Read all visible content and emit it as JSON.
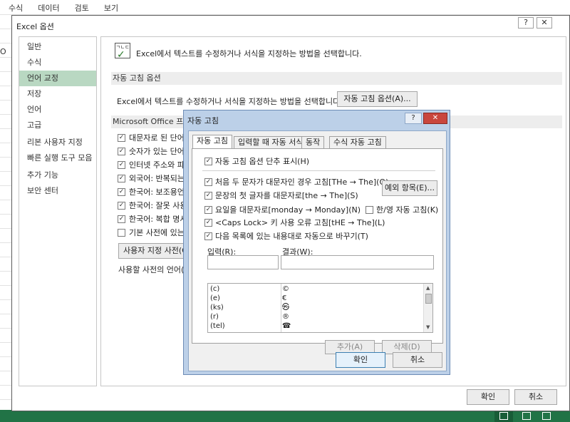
{
  "excel": {
    "ribbon_tabs": [
      "수식",
      "데이터",
      "검토",
      "보기"
    ],
    "cell_fragment": "O"
  },
  "options_dialog": {
    "title": "Excel 옵션",
    "help_icon": "?",
    "close_icon": "✕",
    "nav_items": [
      "일반",
      "수식",
      "언어 교정",
      "저장",
      "언어",
      "고급",
      "리본 사용자 지정",
      "빠른 실행 도구 모음",
      "추가 기능",
      "보안 센터"
    ],
    "selected_nav": "언어 교정",
    "header_icon_text": "ㄱㄴㄷ",
    "header_text": "Excel에서 텍스트를 수정하거나 서식을 지정하는 방법을 선택합니다.",
    "autocorrect_section": "자동 고침 옵션",
    "autocorrect_desc": "Excel에서 텍스트를 수정하거나 서식을 지정하는 방법을 선택합니다.",
    "autocorrect_button": "자동 고침 옵션(A)...",
    "office_section": "Microsoft Office 프로",
    "checkboxes": [
      {
        "label": "대문자로 된 단어",
        "checked": true
      },
      {
        "label": "숫자가 있는 단어",
        "checked": true
      },
      {
        "label": "인터넷 주소와 파",
        "checked": true
      },
      {
        "label": "외국어: 반복되는",
        "checked": true
      },
      {
        "label": "한국어: 보조용언",
        "checked": true
      },
      {
        "label": "한국어: 잘못 사용",
        "checked": true
      },
      {
        "label": "한국어: 복합 명사",
        "checked": true
      },
      {
        "label": "기본 사전에 있는",
        "checked": false
      }
    ],
    "custom_dict_button": "사용자 지정 사전(C",
    "dict_language_label": "사용할 사전의 언어(I",
    "ok_button": "확인",
    "cancel_button": "취소"
  },
  "autocorrect_dialog": {
    "title": "자동 고침",
    "help_icon": "?",
    "close_icon": "✕",
    "tabs": [
      "자동 고침",
      "입력할 때 자동 서식",
      "동작",
      "수식 자동 고침"
    ],
    "active_tab": "자동 고침",
    "show_buttons": {
      "label": "자동 고침 옵션 단추 표시(H)",
      "checked": true
    },
    "options": [
      {
        "label": "처음 두 문자가 대문자인 경우 고침[THe → The](O)",
        "checked": true
      },
      {
        "label": "문장의 첫 글자를 대문자로[the → The](S)",
        "checked": true
      },
      {
        "label": "요일을 대문자로[monday → Monday](N)",
        "checked": true
      },
      {
        "label": "<Caps Lock> 키 사용 오류 고침[tHE → The](L)",
        "checked": true
      }
    ],
    "exceptions_button": "예외 항목(E)...",
    "hangul_option": {
      "label": "한/영 자동 고침(K)",
      "checked": false
    },
    "replace_option": {
      "label": "다음 목록에 있는 내용대로 자동으로 바꾸기(T)",
      "checked": true
    },
    "input_label": "입력(R):",
    "result_label": "결과(W):",
    "list": [
      {
        "key": "(c)",
        "value": "©"
      },
      {
        "key": "(e)",
        "value": "€"
      },
      {
        "key": "(ks)",
        "value": "㉿"
      },
      {
        "key": "(r)",
        "value": "®"
      },
      {
        "key": "(tel)",
        "value": "☎"
      }
    ],
    "add_button": "추가(A)",
    "delete_button": "삭제(D)",
    "ok_button": "확인",
    "cancel_button": "취소"
  }
}
